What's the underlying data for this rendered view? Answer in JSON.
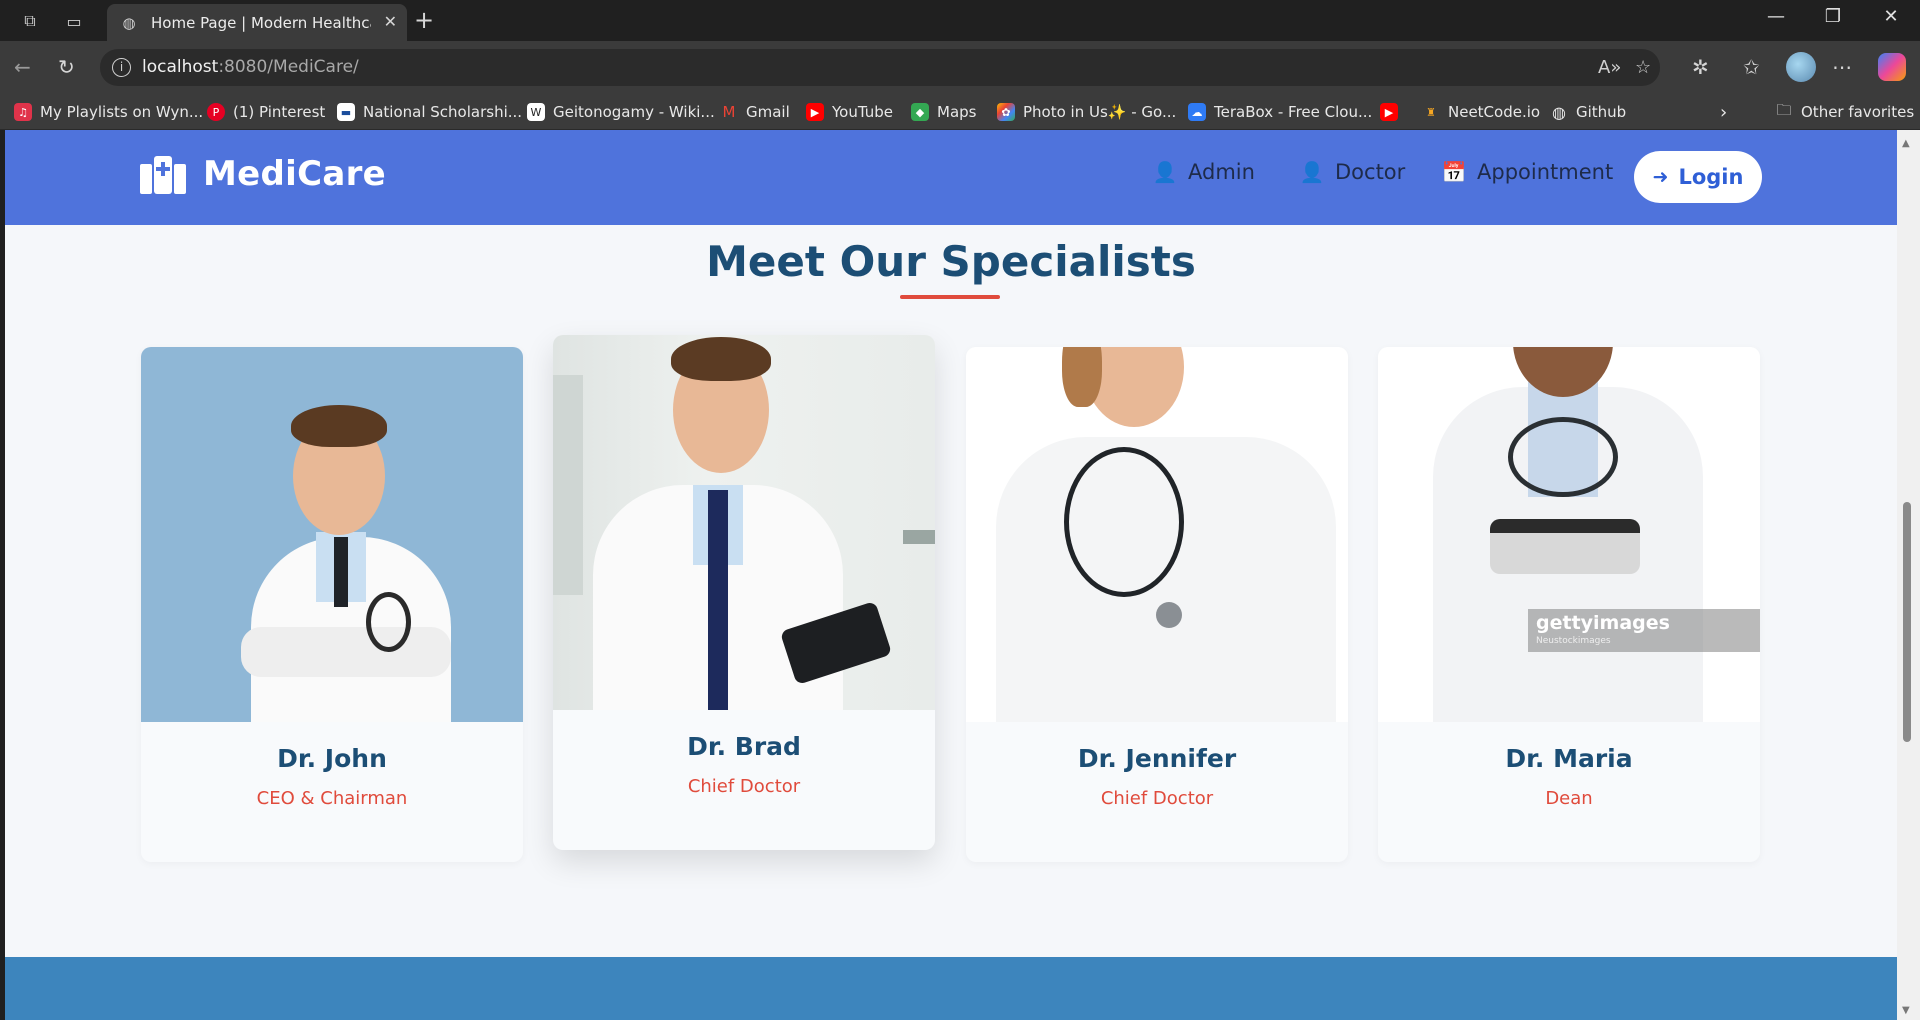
{
  "browser": {
    "tab_title": "Home Page | Modern Healthcare",
    "url_host": "localhost",
    "url_path": ":8080/MediCare/",
    "bookmarks": [
      "My Playlists on Wyn...",
      "(1) Pinterest",
      "National Scholarshi...",
      "Geitonogamy - Wiki...",
      "Gmail",
      "YouTube",
      "Maps",
      "Photo in Us✨ - Go...",
      "TeraBox - Free Clou...",
      "",
      "NeetCode.io",
      "Github"
    ],
    "other_favorites": "Other favorites"
  },
  "header": {
    "logo_text": "MediCare",
    "nav": {
      "admin": "Admin",
      "doctor": "Doctor",
      "appointment": "Appointment"
    },
    "login_label": "Login"
  },
  "section": {
    "title": "Meet Our Specialists"
  },
  "doctors": [
    {
      "name": "Dr. John",
      "role": "CEO & Chairman"
    },
    {
      "name": "Dr. Brad",
      "role": "Chief Doctor"
    },
    {
      "name": "Dr. Jennifer",
      "role": "Chief Doctor"
    },
    {
      "name": "Dr. Maria",
      "role": "Dean"
    }
  ],
  "watermark": {
    "brand": "gettyimages",
    "credit": "Neustockimages"
  },
  "colors": {
    "header_bg": "#4f73dc",
    "title": "#1c4e75",
    "accent": "#e04b3c",
    "footer": "#3d85bd"
  }
}
